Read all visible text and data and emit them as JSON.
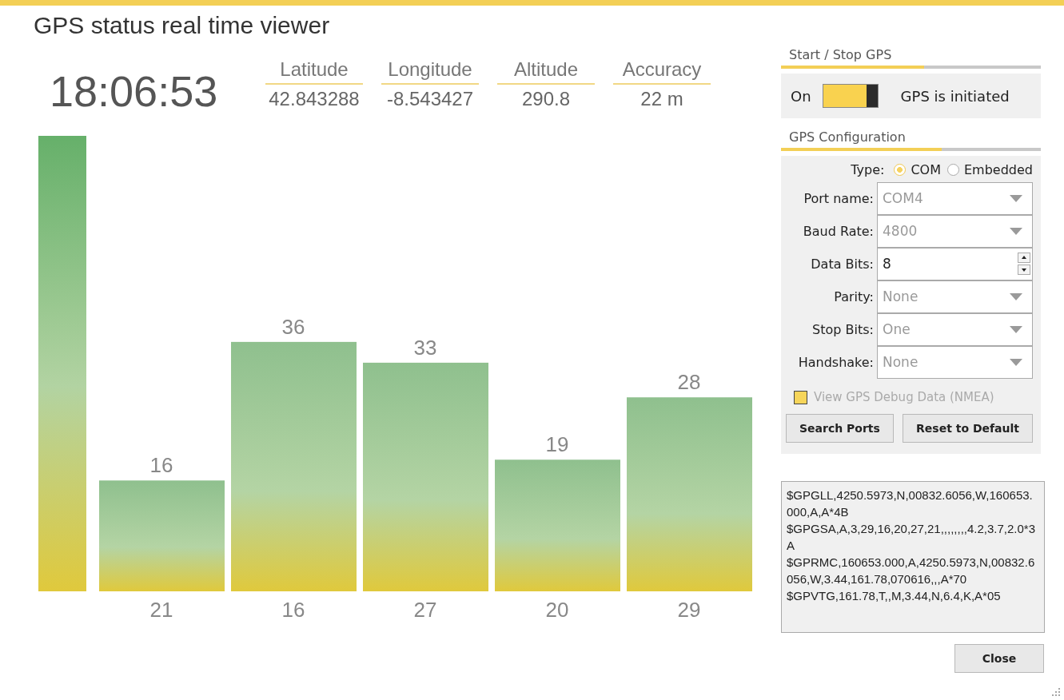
{
  "window": {
    "title": "GPS status real time viewer"
  },
  "clock": "18:06:53",
  "stats": [
    {
      "label": "Latitude",
      "value": "42.843288"
    },
    {
      "label": "Longitude",
      "value": "-8.543427"
    },
    {
      "label": "Altitude",
      "value": "290.8"
    },
    {
      "label": "Accuracy",
      "value": "22 m"
    }
  ],
  "signal_chart": {
    "chart_data": {
      "type": "bar",
      "categories": [
        "21",
        "16",
        "27",
        "20",
        "29"
      ],
      "values": [
        16,
        36,
        33,
        19,
        28
      ],
      "data_labels": true
    }
  },
  "start_stop": {
    "heading": "Start / Stop GPS",
    "toggle_label": "On",
    "on": true,
    "status": "GPS is initiated"
  },
  "config": {
    "heading": "GPS Configuration",
    "type_label": "Type:",
    "type_options": [
      {
        "label": "COM",
        "selected": true
      },
      {
        "label": "Embedded",
        "selected": false
      }
    ],
    "fields": [
      {
        "kind": "dropdown",
        "label": "Port name:",
        "value": "COM4",
        "disabled": true
      },
      {
        "kind": "dropdown",
        "label": "Baud Rate:",
        "value": "4800",
        "disabled": true
      },
      {
        "kind": "spinner",
        "label": "Data Bits:",
        "value": "8",
        "disabled": false
      },
      {
        "kind": "dropdown",
        "label": "Parity:",
        "value": "None",
        "disabled": true
      },
      {
        "kind": "dropdown",
        "label": "Stop Bits:",
        "value": "One",
        "disabled": true
      },
      {
        "kind": "dropdown",
        "label": "Handshake:",
        "value": "None",
        "disabled": true
      }
    ],
    "debug_checkbox": {
      "label": "View GPS Debug Data (NMEA)",
      "checked": true
    },
    "buttons": [
      "Search Ports",
      "Reset to Default"
    ]
  },
  "debug_output": [
    "$GPGLL,4250.5973,N,00832.6056,W,160653.000,A,A*4B",
    "$GPGSA,A,3,29,16,20,27,21,,,,,,,,4.2,3.7,2.0*3A",
    "$GPRMC,160653.000,A,4250.5973,N,00832.6056,W,3.44,161.78,070616,,,A*70",
    "$GPVTG,161.78,T,,M,3.44,N,6.4,K,A*05"
  ],
  "close_button": "Close"
}
